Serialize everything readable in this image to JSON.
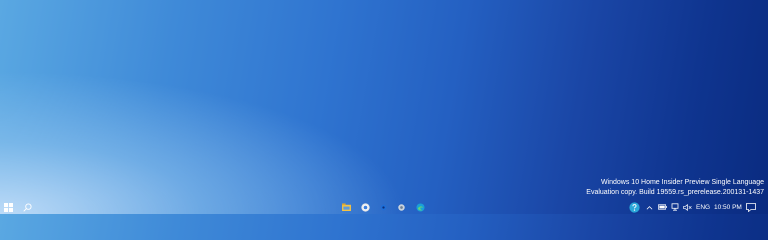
{
  "desktop": {
    "watermark": {
      "line1": "Windows 10 Home Insider Preview Single Language",
      "line2": "Evaluation copy. Build 19559.rs_prerelease.200131-1437"
    }
  },
  "taskbar": {
    "start_icon": "windows-logo-icon",
    "search_icon": "search-icon",
    "pinned_apps": [
      "file-explorer-icon",
      "chrome-icon",
      "app-icon",
      "settings-icon",
      "edge-icon"
    ],
    "tray": {
      "language": "ENG",
      "time": "10:50 PM"
    }
  },
  "colors": {
    "accent": "#2f74d0",
    "desktop_dark": "#0a2b80",
    "desktop_light": "#9fcdf2"
  }
}
